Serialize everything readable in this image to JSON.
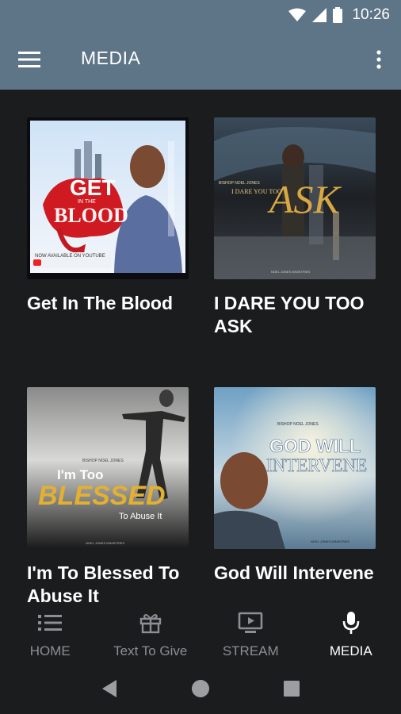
{
  "status_bar": {
    "time": "10:26"
  },
  "app_bar": {
    "title": "MEDIA"
  },
  "media": [
    {
      "title": "Get In The Blood",
      "art": {
        "line1": "GET",
        "line2": "BLOOD",
        "small": "IN THE",
        "banner": "NOW AVAILABLE ON YOUTUBE"
      }
    },
    {
      "title": "I DARE YOU TOO ASK",
      "art": {
        "byline": "BISHOP NOEL JONES",
        "subtitle": "I DARE YOU TOO",
        "big": "ASK",
        "footer": "NOEL JONES MINISTRIES"
      }
    },
    {
      "title": "I'm To Blessed To Abuse It",
      "art": {
        "byline": "BISHOP NOEL JONES",
        "line1": "I'm Too",
        "big": "BLESSED",
        "line3": "To Abuse It",
        "footer": "NOEL JONES MINISTRIES"
      }
    },
    {
      "title": "God Will Intervene",
      "art": {
        "byline": "BISHOP NOEL JONES",
        "line1": "GOD WILL",
        "line2": "INTERVENE",
        "footer": "NOEL JONES MINISTRIES"
      }
    }
  ],
  "bottom_nav": [
    {
      "label": "HOME",
      "icon": "list-icon",
      "active": false
    },
    {
      "label": "Text To Give",
      "icon": "gift-icon",
      "active": false
    },
    {
      "label": "STREAM",
      "icon": "tv-icon",
      "active": false
    },
    {
      "label": "MEDIA",
      "icon": "microphone-icon",
      "active": true
    }
  ],
  "colors": {
    "app_bar": "#5e7487",
    "background": "#1b1c1e",
    "nav_inactive": "#8c8f93",
    "nav_active": "#ffffff"
  }
}
